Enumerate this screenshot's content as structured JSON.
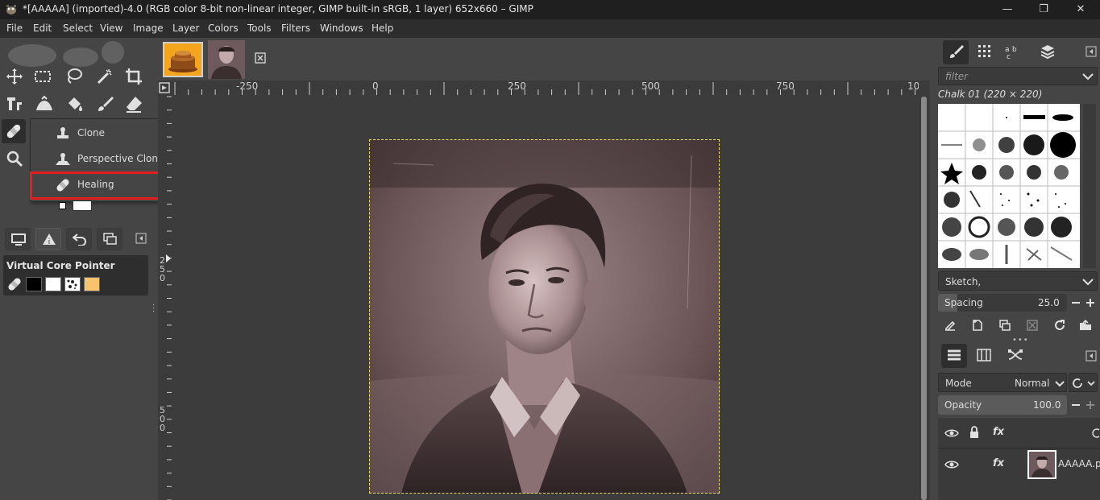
{
  "window": {
    "title": "*[AAAAA] (imported)-4.0 (RGB color 8-bit non-linear integer, GIMP built-in sRGB, 1 layer) 652x660 – GIMP",
    "minimize": "—",
    "maximize": "❐",
    "close": "✕"
  },
  "menu": [
    "File",
    "Edit",
    "Select",
    "View",
    "Image",
    "Layer",
    "Colors",
    "Tools",
    "Filters",
    "Windows",
    "Help"
  ],
  "flyout": {
    "items": [
      {
        "label": "Clone",
        "key": "C",
        "icon": "clone-stamp-icon"
      },
      {
        "label": "Perspective Clone",
        "key": "",
        "icon": "perspective-clone-icon"
      },
      {
        "label": "Healing",
        "key": "H",
        "icon": "healing-bandage-icon"
      }
    ],
    "highlight_color": "#e41e1e"
  },
  "device_status": {
    "title": "Virtual Core Pointer",
    "foreground": "#000000",
    "background": "#ffffff",
    "pattern_color": "#f7c36e"
  },
  "rulers": {
    "h_labels": [
      "-250",
      "0",
      "250",
      "500",
      "750",
      "10"
    ],
    "v_labels": [
      "250",
      "500"
    ]
  },
  "brushes": {
    "filter_placeholder": "filter",
    "current": "Chalk 01 (220 × 220)",
    "tag": "Sketch,",
    "spacing_label": "Spacing",
    "spacing_value": "25.0"
  },
  "layers": {
    "mode_label": "Mode",
    "mode_value": "Normal",
    "opacity_label": "Opacity",
    "opacity_value": "100.0",
    "layer_name": "AAAAA.p"
  },
  "colors": {
    "accent": "#e41e1e",
    "selection": "#f0e060",
    "titlebar": "#1f1f1f",
    "panel": "#454545"
  }
}
